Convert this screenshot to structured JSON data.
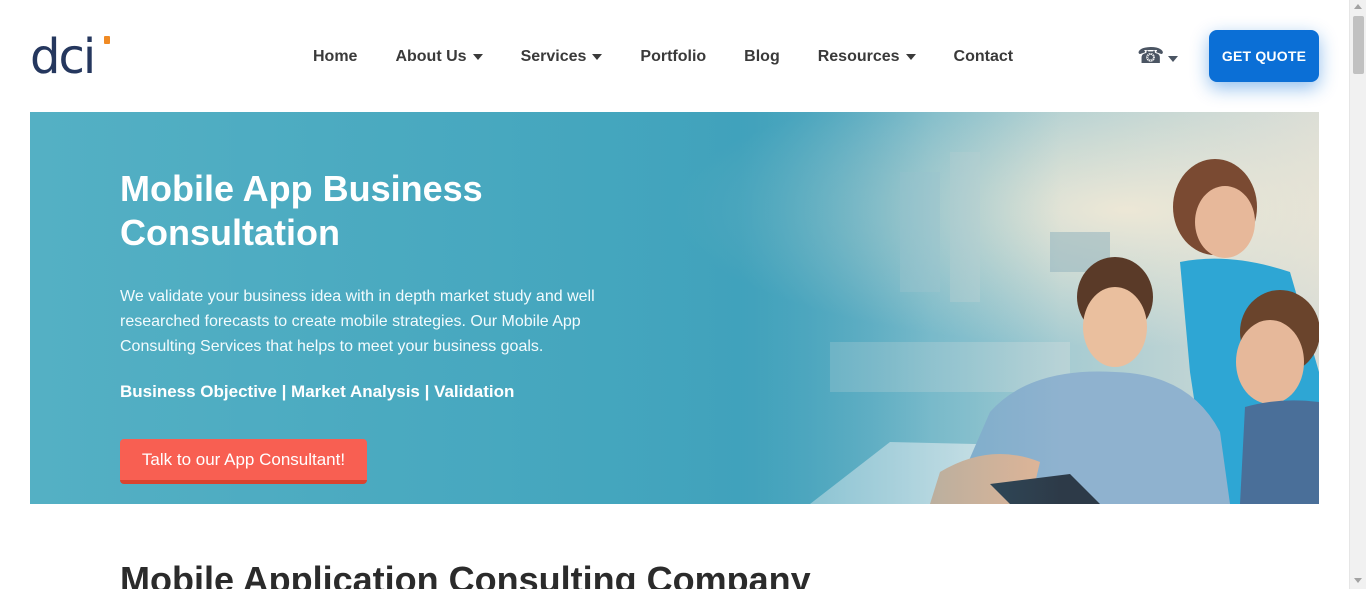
{
  "brand": {
    "logo_text": "dci"
  },
  "nav": {
    "items": [
      {
        "label": "Home",
        "has_dropdown": false
      },
      {
        "label": "About Us",
        "has_dropdown": true
      },
      {
        "label": "Services",
        "has_dropdown": true
      },
      {
        "label": "Portfolio",
        "has_dropdown": false
      },
      {
        "label": "Blog",
        "has_dropdown": false
      },
      {
        "label": "Resources",
        "has_dropdown": true
      },
      {
        "label": "Contact",
        "has_dropdown": false
      }
    ],
    "phone_icon": "phone-icon",
    "quote_label": "GET QUOTE"
  },
  "hero": {
    "title": "Mobile App Business Consultation",
    "description": "We validate your business idea with in depth market study and well researched forecasts to create mobile strategies. Our Mobile App Consulting Services that helps to meet your business goals.",
    "tags": "Business Objective | Market Analysis | Validation",
    "cta_label": "Talk to our App Consultant!"
  },
  "section": {
    "title": "Mobile Application Consulting Company"
  },
  "colors": {
    "brand_navy": "#25375e",
    "logo_accent": "#f08a24",
    "quote_button": "#0b6fd6",
    "cta_button": "#f85f52",
    "hero_teal": "#4aaac0"
  }
}
